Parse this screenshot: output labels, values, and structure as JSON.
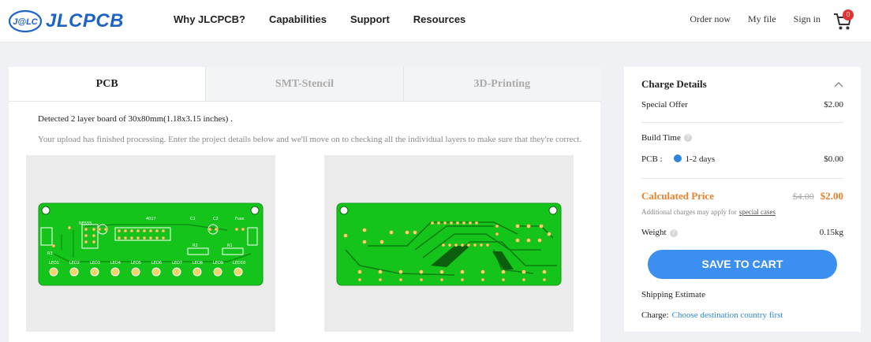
{
  "header": {
    "logo_mark_text": "J@LC",
    "logo_text": "JLCPCB",
    "nav": [
      "Why JLCPCB?",
      "Capabilities",
      "Support",
      "Resources"
    ],
    "right_links": [
      "Order now",
      "My file",
      "Sign in"
    ],
    "cart_count": "0"
  },
  "tabs": [
    "PCB",
    "SMT-Stencil",
    "3D-Printing"
  ],
  "upload": {
    "detected": "Detected 2 layer board of 30x80mm(1.18x3.15 inches) .",
    "message": "Your upload has finished processing. Enter the project details below and we'll move on to checking all the individual layers to make sure that they're correct."
  },
  "pcb_labels": {
    "top": [
      "4017",
      "C1",
      "C2",
      "Fuse",
      "NE555",
      "R1",
      "R2",
      "R3",
      "LED1",
      "LED2",
      "LED3",
      "LED4",
      "LED5",
      "LED6",
      "LED7",
      "LED8",
      "LED9",
      "LED10"
    ]
  },
  "charge": {
    "title": "Charge Details",
    "special_offer_label": "Special Offer",
    "special_offer_value": "$2.00",
    "build_time_label": "Build Time",
    "pcb_label": "PCB :",
    "pcb_option": "1-2 days",
    "pcb_price": "$0.00",
    "calculated_label": "Calculated Price",
    "old_price": "$4.00",
    "new_price": "$2.00",
    "note_prefix": "Additional charges may apply for ",
    "note_link": "special cases",
    "weight_label": "Weight",
    "weight_value": "0.15kg",
    "save_button": "SAVE TO CART",
    "shipping_label": "Shipping Estimate",
    "charge_label": "Charge:",
    "charge_link": "Choose destination country first"
  },
  "colors": {
    "brand": "#1f63c6",
    "accent_button": "#3a8ff0",
    "price_orange": "#e8822e",
    "pcb_green": "#15c41b"
  }
}
